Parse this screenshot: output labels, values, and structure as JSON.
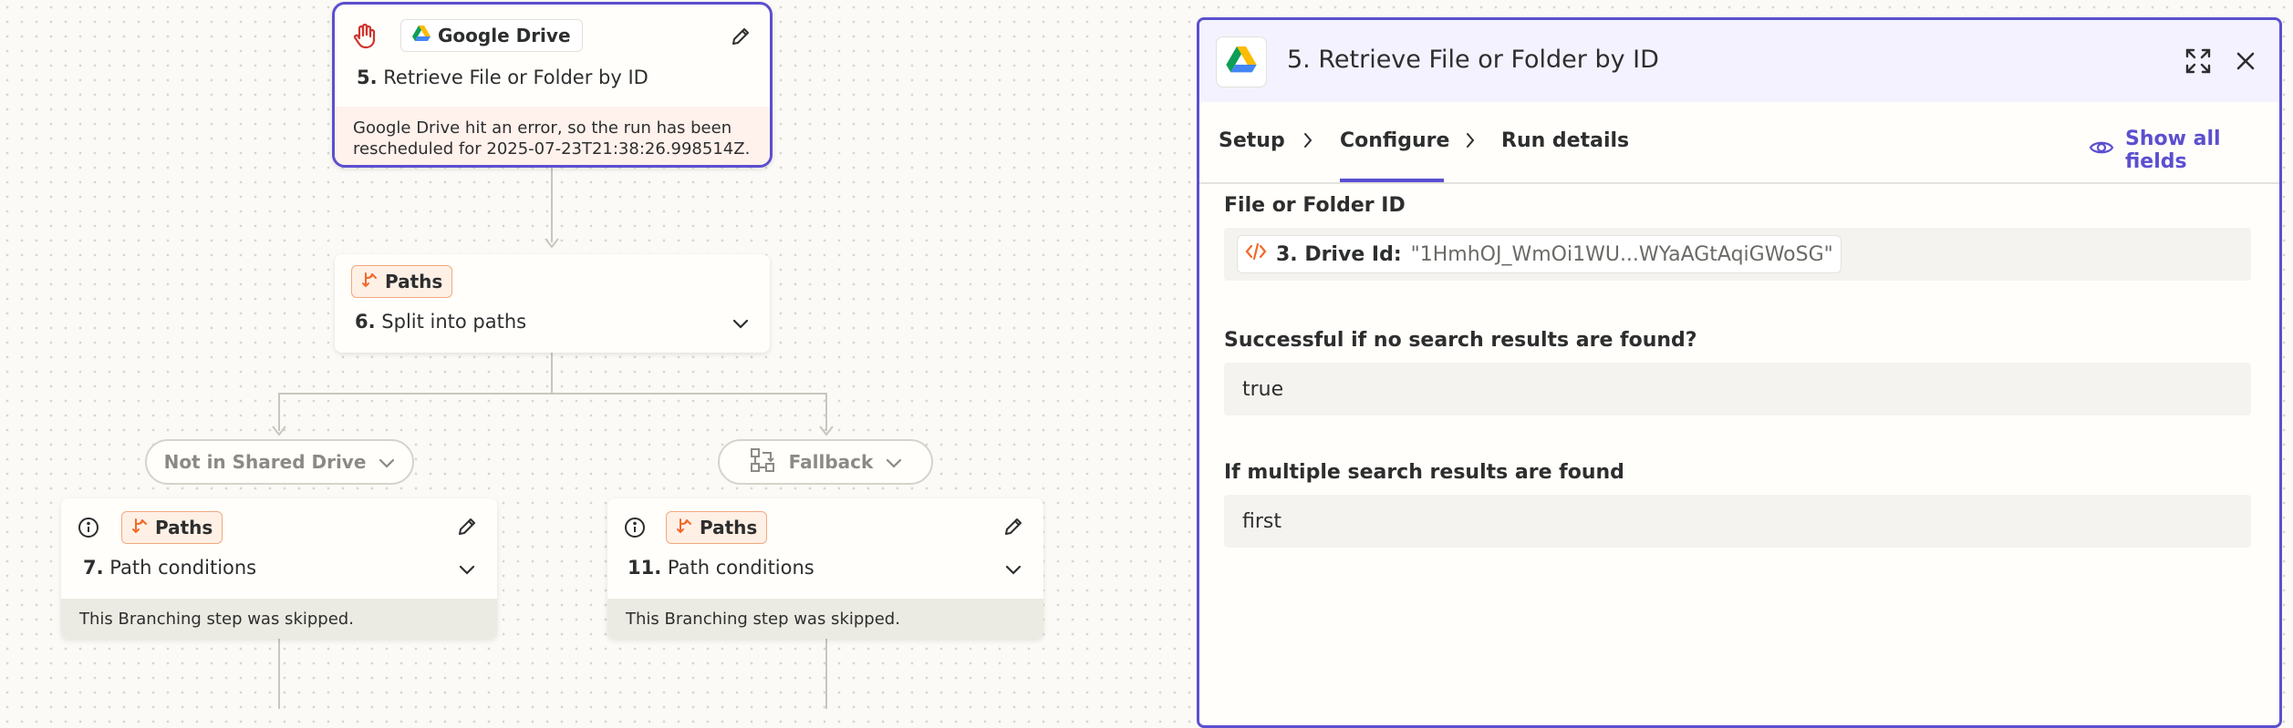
{
  "canvas": {
    "step5": {
      "app_chip": "Google Drive",
      "number": "5.",
      "title": "Retrieve File or Folder by ID",
      "error_text": "Google Drive hit an error, so the run has been rescheduled for 2025-07-23T21:38:26.998514Z."
    },
    "step6": {
      "chip": "Paths",
      "number": "6.",
      "title": "Split into paths"
    },
    "branch_left": {
      "label": "Not in Shared Drive"
    },
    "branch_right": {
      "label": "Fallback"
    },
    "step7": {
      "chip": "Paths",
      "number": "7.",
      "title": "Path conditions",
      "status": "This Branching step was skipped."
    },
    "step11": {
      "chip": "Paths",
      "number": "11.",
      "title": "Path conditions",
      "status": "This Branching step was skipped."
    }
  },
  "panel": {
    "title": "5. Retrieve File or Folder by ID",
    "tabs": [
      {
        "label": "Setup"
      },
      {
        "label": "Configure"
      },
      {
        "label": "Run details"
      }
    ],
    "active_tab": "Configure",
    "show_all_fields": "Show all fields",
    "fields": [
      {
        "label": "File or Folder ID",
        "token_label": "3. Drive Id:",
        "token_value": "\"1HmhOJ_WmOi1WU...WYaAGtAqiGWoSG\""
      },
      {
        "label": "Successful if no search results are found?",
        "value": "true"
      },
      {
        "label": "If multiple search results are found",
        "value": "first"
      }
    ]
  },
  "colors": {
    "accent": "#5b4fcf",
    "paths_orange": "#f06a2a",
    "error_bg": "#fff1ec",
    "hand_red": "#d1332e"
  },
  "icons": {
    "hand": "hand-icon",
    "drive": "google-drive-icon",
    "edit": "pencil-icon",
    "paths": "paths-icon",
    "info": "info-icon",
    "chevron": "chevron-down-icon",
    "fallback": "fallback-icon",
    "expand": "expand-icon",
    "close": "close-icon",
    "eye": "eye-icon",
    "code": "code-icon"
  }
}
